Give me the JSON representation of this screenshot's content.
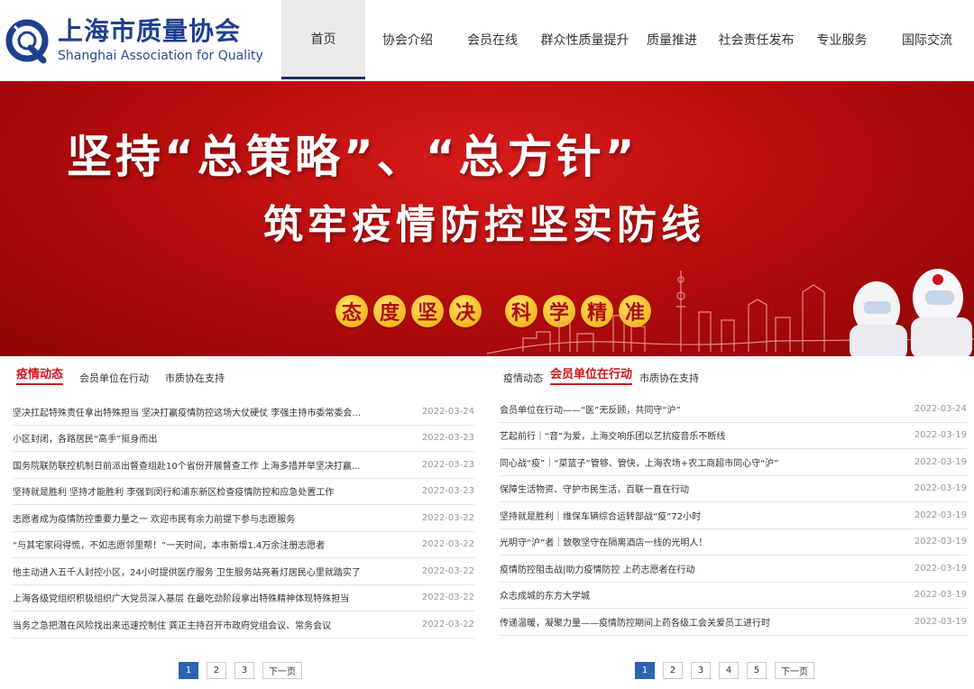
{
  "logo": {
    "cn": "上海市质量协会",
    "en": "Shanghai Association for Quality"
  },
  "colors": {
    "brand": "#1f3f8e",
    "accent": "#d0121b",
    "banner": "#c01010",
    "pager_active": "#2b63b6"
  },
  "nav": [
    {
      "label": "首页",
      "active": true
    },
    {
      "label": "协会介绍"
    },
    {
      "label": "会员在线"
    },
    {
      "label": "群众性质量提升"
    },
    {
      "label": "质量推进"
    },
    {
      "label": "社会责任发布"
    },
    {
      "label": "专业服务"
    },
    {
      "label": "国际交流"
    }
  ],
  "banner": {
    "line1": "坚持“总策略”、“总方针”",
    "line2": "筑牢疫情防控坚实防线",
    "badges": [
      "态",
      "度",
      "坚",
      "决",
      "科",
      "学",
      "精",
      "准"
    ]
  },
  "left": {
    "tabs": [
      "疫情动态",
      "会员单位在行动",
      "市质协在支持"
    ],
    "active_tab": 0,
    "news": [
      {
        "title": "坚决扛起特殊责任拿出特殊担当 坚决打赢疫情防控这场大仗硬仗 李强主持市委常委会...",
        "date": "2022-03-24"
      },
      {
        "title": "小区封闭，各路居民“高手”挺身而出",
        "date": "2022-03-23"
      },
      {
        "title": "国务院联防联控机制日前派出督查组赴10个省份开展督查工作 上海多措并举坚决打赢...",
        "date": "2022-03-23"
      },
      {
        "title": "坚持就是胜利 坚持才能胜利 李强到闵行和浦东新区检查疫情防控和应急处置工作",
        "date": "2022-03-23"
      },
      {
        "title": "志愿者成为疫情防控重要力量之一 欢迎市民有余力前提下参与志愿服务",
        "date": "2022-03-22"
      },
      {
        "title": "“与其宅家闷得慌，不如志愿邻里帮！”一天时间，本市新增1.4万余注册志愿者",
        "date": "2022-03-22"
      },
      {
        "title": "他主动进入五千人封控小区，24小时提供医疗服务 卫生服务站亮着灯居民心里就踏实了",
        "date": "2022-03-22"
      },
      {
        "title": "上海各级党组织积极组织广大党员深入基层 在最吃劲阶段拿出特殊精神体现特殊担当",
        "date": "2022-03-22"
      },
      {
        "title": "当务之急把潜在风险找出来迅速控制住 龚正主持召开市政府党组会议、常务会议",
        "date": "2022-03-22"
      }
    ],
    "pages": [
      "1",
      "2",
      "3",
      "下一页"
    ]
  },
  "right": {
    "tabs": [
      "疫情动态",
      "会员单位在行动",
      "市质协在支持"
    ],
    "active_tab": 1,
    "news": [
      {
        "title": "会员单位在行动——“医”无反顾，共同守“沪”",
        "date": "2022-03-24"
      },
      {
        "title": "艺起前行｜“音”为爱，上海交响乐团以艺抗疫音乐不断线",
        "date": "2022-03-19"
      },
      {
        "title": "同心战“疫”｜“菜篮子”管够、管快，上海农场+农工商超市同心守“沪”",
        "date": "2022-03-19"
      },
      {
        "title": "保障生活物资、守护市民生活，百联一直在行动",
        "date": "2022-03-19"
      },
      {
        "title": "坚持就是胜利｜维保车辆综合运转部战“疫”72小时",
        "date": "2022-03-19"
      },
      {
        "title": "光明守“沪”者｜致敬坚守在隔离酒店一线的光明人！",
        "date": "2022-03-19"
      },
      {
        "title": "疫情防控阻击战|助力疫情防控 上药志愿者在行动",
        "date": "2022-03-19"
      },
      {
        "title": "众志成城的东方大学城",
        "date": "2022-03-19"
      },
      {
        "title": "传递温暖，凝聚力量——疫情防控期间上药各级工会关爱员工进行时",
        "date": "2022-03-19"
      }
    ],
    "pages": [
      "1",
      "2",
      "3",
      "4",
      "5",
      "下一页"
    ]
  }
}
